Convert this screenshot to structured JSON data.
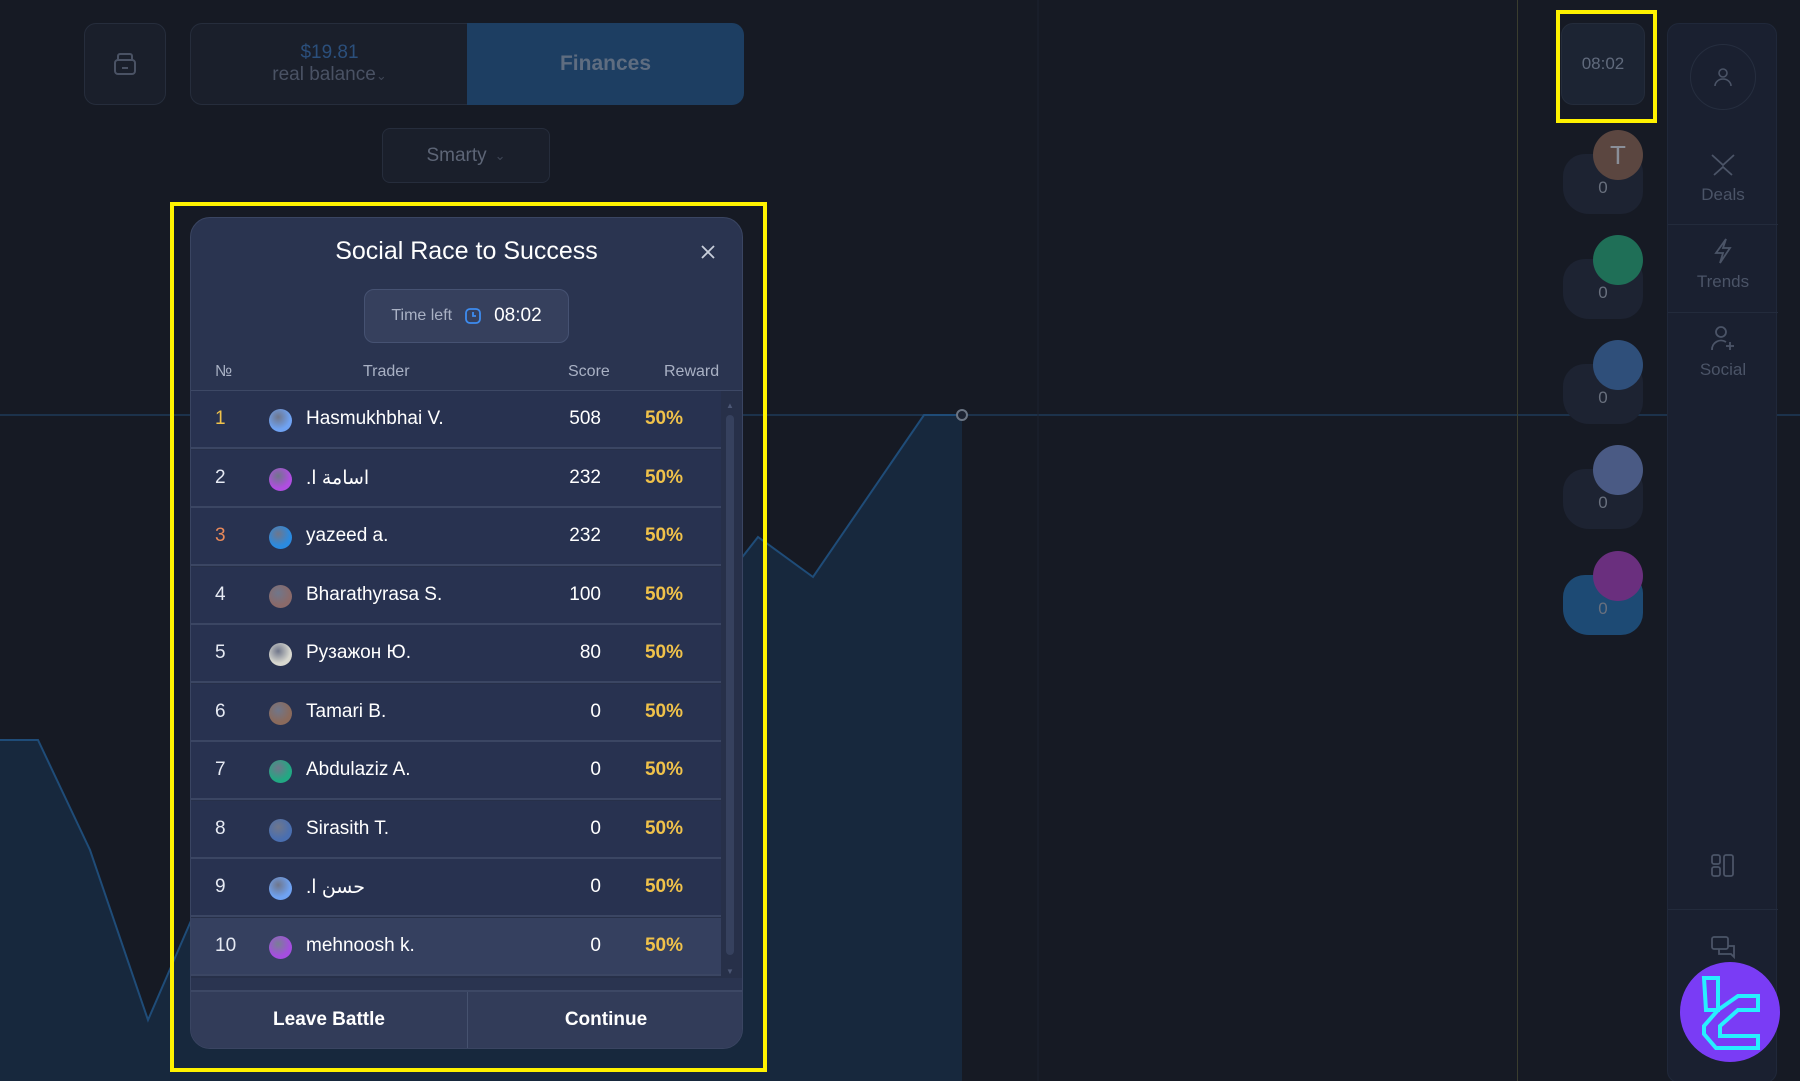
{
  "header": {
    "balance_amount": "$19.81",
    "balance_label": "real balance",
    "finances_label": "Finances",
    "strategy_label": "Smarty"
  },
  "battle_timer": "08:02",
  "right_panel": {
    "items": [
      {
        "label": "Deals",
        "icon": "deals-icon"
      },
      {
        "label": "Trends",
        "icon": "lightning-icon"
      },
      {
        "label": "Social",
        "icon": "add-user-icon"
      }
    ]
  },
  "participants": [
    {
      "initial": "T",
      "score": "0",
      "color": "#5b4640"
    },
    {
      "initial": "",
      "score": "0",
      "color": "#1f7a5c"
    },
    {
      "initial": "",
      "score": "0",
      "color": "#2f4f7a"
    },
    {
      "initial": "",
      "score": "0",
      "color": "#4a5a84"
    },
    {
      "initial": "",
      "score": "0",
      "color": "#6a2f7e"
    }
  ],
  "modal": {
    "title": "Social Race to Success",
    "time_left_label": "Time left",
    "time_left_value": "08:02",
    "columns": {
      "rank": "№",
      "trader": "Trader",
      "score": "Score",
      "reward": "Reward"
    },
    "rows": [
      {
        "rank": "1",
        "name": "Hasmukhbhai V.",
        "score": "508",
        "reward": "50%",
        "rank_color": "#f0c24a",
        "avatar": "#6fa2f2"
      },
      {
        "rank": "2",
        "name": "اسامة ا.",
        "score": "232",
        "reward": "50%",
        "rank_color": "#e6eaf3",
        "avatar": "#b04ee0"
      },
      {
        "rank": "3",
        "name": "yazeed a.",
        "score": "232",
        "reward": "50%",
        "rank_color": "#e8895a",
        "avatar": "#2a8ae0"
      },
      {
        "rank": "4",
        "name": "Bharathyrasa S.",
        "score": "100",
        "reward": "50%",
        "rank_color": "#e6eaf3",
        "avatar": "#8a6a6a"
      },
      {
        "rank": "5",
        "name": "Рузажон Ю.",
        "score": "80",
        "reward": "50%",
        "rank_color": "#e6eaf3",
        "avatar": "#d8d8d0"
      },
      {
        "rank": "6",
        "name": "Tamari B.",
        "score": "0",
        "reward": "50%",
        "rank_color": "#e6eaf3",
        "avatar": "#8a6a5c"
      },
      {
        "rank": "7",
        "name": "Abdulaziz A.",
        "score": "0",
        "reward": "50%",
        "rank_color": "#e6eaf3",
        "avatar": "#22a883"
      },
      {
        "rank": "8",
        "name": "Sirasith T.",
        "score": "0",
        "reward": "50%",
        "rank_color": "#e6eaf3",
        "avatar": "#4a6fb0"
      },
      {
        "rank": "9",
        "name": "حسن ا.",
        "score": "0",
        "reward": "50%",
        "rank_color": "#e6eaf3",
        "avatar": "#6fa2f2"
      },
      {
        "rank": "10",
        "name": "mehnoosh k.",
        "score": "0",
        "reward": "50%",
        "rank_color": "#e6eaf3",
        "avatar": "#a54ee0",
        "current_user": true
      }
    ],
    "leave_label": "Leave Battle",
    "continue_label": "Continue"
  },
  "colors": {
    "accent": "#1d3e62",
    "reward": "#f0c24a",
    "highlight": "#fff200",
    "brand_badge": "#7a3cf5"
  }
}
